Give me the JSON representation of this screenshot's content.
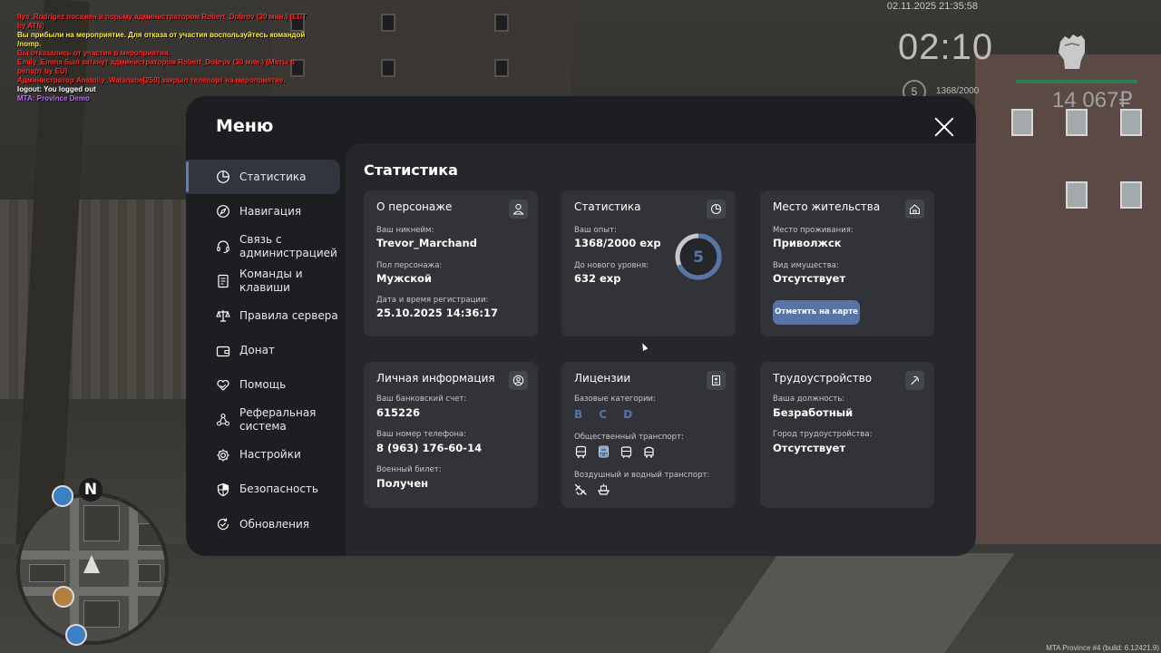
{
  "chat": [
    {
      "text": "Ilya_Rodrigez посажен в порьму администратором Robert_Dobrov (30 мин.) (ЕПТ by ATN)",
      "color": "#ff2a2a"
    },
    {
      "text": "Вы прибыли на мероприятие. Для отказа от участия воспользуйтесь командой /nomp.",
      "color": "#ffef3a"
    },
    {
      "text": "Вы отказались от участия в мероприятии.",
      "color": "#ff2a2a"
    },
    {
      "text": "Emily_Emma был заткнут администратором Robert_Dobrov (30 мин.) (Маты в репорт by EU)",
      "color": "#ff2a2a"
    },
    {
      "text": "Администратор Anatoliy_Watanabe[250] закрыл телепорт на мероприятие.",
      "color": "#ff2a2a"
    },
    {
      "text": "logout: You logged out",
      "color": "#ffffff"
    },
    {
      "text": "MTA: Province Demo",
      "color": "#c06dff"
    }
  ],
  "hud": {
    "datetime": "02.11.2025 21:35:58",
    "clock": "02:10",
    "level": "5",
    "exp": "1368/2000",
    "money": "14 067₽",
    "build": "MTA Province #4 (build: 6.12421.9)"
  },
  "radar": {
    "north": "N"
  },
  "menu": {
    "title": "Меню",
    "nav": [
      {
        "label": "Статистика",
        "icon": "pie-chart-icon",
        "active": true
      },
      {
        "label": "Навигация",
        "icon": "compass-icon",
        "active": false
      },
      {
        "label": "Связь с администрацией",
        "icon": "headset-icon",
        "active": false
      },
      {
        "label": "Команды и клавиши",
        "icon": "document-icon",
        "active": false
      },
      {
        "label": "Правила сервера",
        "icon": "scales-icon",
        "active": false
      },
      {
        "label": "Донат",
        "icon": "wallet-icon",
        "active": false
      },
      {
        "label": "Помощь",
        "icon": "heart-hand-icon",
        "active": false
      },
      {
        "label": "Реферальная система",
        "icon": "network-icon",
        "active": false
      },
      {
        "label": "Настройки",
        "icon": "gear-icon",
        "active": false
      },
      {
        "label": "Безопасность",
        "icon": "shield-icon",
        "active": false
      },
      {
        "label": "Обновления",
        "icon": "refresh-check-icon",
        "active": false
      }
    ]
  },
  "stats": {
    "heading": "Статистика",
    "character": {
      "title": "О персонаже",
      "nickname_label": "Ваш никнейм:",
      "nickname": "Trevor_Marchand",
      "gender_label": "Пол персонажа:",
      "gender": "Мужской",
      "reg_label": "Дата и время регистрации:",
      "reg": "25.10.2025 14:36:17"
    },
    "statistics": {
      "title": "Статистика",
      "exp_label": "Ваш опыт:",
      "exp": "1368/2000 exp",
      "next_label": "До нового уровня:",
      "next": "632 exp",
      "level": "5",
      "progress": 0.684
    },
    "residence": {
      "title": "Место жительства",
      "place_label": "Место проживания:",
      "place": "Приволжск",
      "property_label": "Вид имущества:",
      "property": "Отсутствует",
      "map_button": "Отметить на карте"
    },
    "personal": {
      "title": "Личная информация",
      "bank_label": "Ваш банковский счет:",
      "bank": "615226",
      "phone_label": "Ваш номер телефона:",
      "phone": "8 (963) 176-60-14",
      "military_label": "Военный билет:",
      "military": "Получен"
    },
    "licenses": {
      "title": "Лицензии",
      "base_label": "Базовые категории:",
      "base": "B C D",
      "public_label": "Общественный транспорт:",
      "public_icons": [
        "bus-icon",
        "bus-front-icon",
        "tram-icon",
        "trolleybus-icon"
      ],
      "air_label": "Воздушный и водный транспорт:",
      "air_icons": [
        "airplane-icon",
        "boat-icon"
      ]
    },
    "employment": {
      "title": "Трудоустройство",
      "position_label": "Ваша должность:",
      "position": "Безработный",
      "city_label": "Город трудоустройства:",
      "city": "Отсутствует"
    }
  },
  "colors": {
    "accent": "#5675a6",
    "panel": "#313338",
    "window": "#1d1e21"
  }
}
